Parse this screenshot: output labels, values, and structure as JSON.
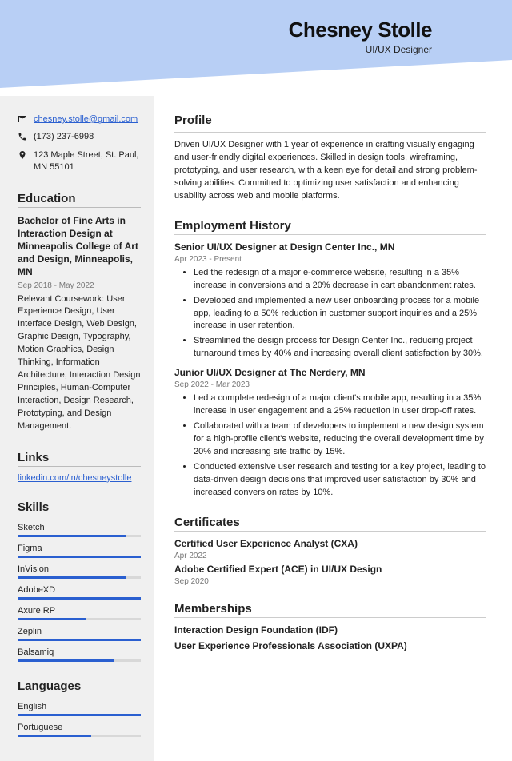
{
  "header": {
    "name": "Chesney Stolle",
    "title": "UI/UX Designer"
  },
  "colors": {
    "band": "#b8cff5",
    "accent": "#2a5fd0"
  },
  "contact": {
    "email": "chesney.stolle@gmail.com",
    "phone": "(173) 237-6998",
    "address": "123 Maple Street, St. Paul, MN 55101"
  },
  "education": {
    "heading": "Education",
    "degree": "Bachelor of Fine Arts in Interaction Design at Minneapolis College of Art and Design, Minneapolis, MN",
    "dates": "Sep 2018 - May 2022",
    "details": "Relevant Coursework: User Experience Design, User Interface Design, Web Design, Graphic Design, Typography, Motion Graphics, Design Thinking, Information Architecture, Interaction Design Principles, Human-Computer Interaction, Design Research, Prototyping, and Design Management."
  },
  "links": {
    "heading": "Links",
    "url": "linkedin.com/in/chesneystolle"
  },
  "skills": {
    "heading": "Skills",
    "items": [
      {
        "name": "Sketch",
        "pct": 88
      },
      {
        "name": "Figma",
        "pct": 100
      },
      {
        "name": "InVision",
        "pct": 88
      },
      {
        "name": "AdobeXD",
        "pct": 100
      },
      {
        "name": "Axure RP",
        "pct": 55
      },
      {
        "name": "Zeplin",
        "pct": 100
      },
      {
        "name": "Balsamiq",
        "pct": 78
      }
    ]
  },
  "languages": {
    "heading": "Languages",
    "items": [
      {
        "name": "English",
        "pct": 100
      },
      {
        "name": "Portuguese",
        "pct": 60
      }
    ]
  },
  "profile": {
    "heading": "Profile",
    "text": "Driven UI/UX Designer with 1 year of experience in crafting visually engaging and user-friendly digital experiences. Skilled in design tools, wireframing, prototyping, and user research, with a keen eye for detail and strong problem-solving abilities. Committed to optimizing user satisfaction and enhancing usability across web and mobile platforms."
  },
  "employment": {
    "heading": "Employment History",
    "jobs": [
      {
        "title": "Senior UI/UX Designer at Design Center Inc., MN",
        "dates": "Apr 2023 - Present",
        "bullets": [
          "Led the redesign of a major e-commerce website, resulting in a 35% increase in conversions and a 20% decrease in cart abandonment rates.",
          "Developed and implemented a new user onboarding process for a mobile app, leading to a 50% reduction in customer support inquiries and a 25% increase in user retention.",
          "Streamlined the design process for Design Center Inc., reducing project turnaround times by 40% and increasing overall client satisfaction by 30%."
        ]
      },
      {
        "title": "Junior UI/UX Designer at The Nerdery, MN",
        "dates": "Sep 2022 - Mar 2023",
        "bullets": [
          "Led a complete redesign of a major client's mobile app, resulting in a 35% increase in user engagement and a 25% reduction in user drop-off rates.",
          "Collaborated with a team of developers to implement a new design system for a high-profile client's website, reducing the overall development time by 20% and increasing site traffic by 15%.",
          "Conducted extensive user research and testing for a key project, leading to data-driven design decisions that improved user satisfaction by 30% and increased conversion rates by 10%."
        ]
      }
    ]
  },
  "certificates": {
    "heading": "Certificates",
    "items": [
      {
        "name": "Certified User Experience Analyst (CXA)",
        "date": "Apr 2022"
      },
      {
        "name": "Adobe Certified Expert (ACE) in UI/UX Design",
        "date": "Sep 2020"
      }
    ]
  },
  "memberships": {
    "heading": "Memberships",
    "items": [
      "Interaction Design Foundation (IDF)",
      "User Experience Professionals Association (UXPA)"
    ]
  }
}
